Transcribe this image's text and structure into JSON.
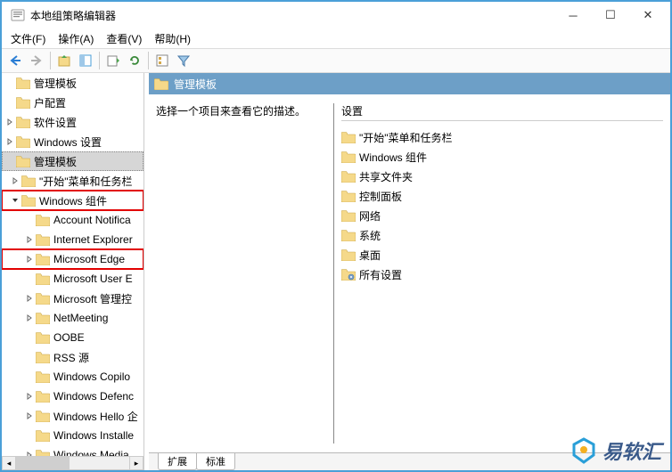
{
  "titlebar": {
    "title": "本地组策略编辑器"
  },
  "menubar": [
    "文件(F)",
    "操作(A)",
    "查看(V)",
    "帮助(H)"
  ],
  "tree": {
    "items": [
      {
        "label": "管理模板",
        "level": 0,
        "arrow": "none"
      },
      {
        "label": "户配置",
        "level": 0,
        "arrow": "none"
      },
      {
        "label": "软件设置",
        "level": 0,
        "arrow": "right"
      },
      {
        "label": "Windows 设置",
        "level": 0,
        "arrow": "right"
      },
      {
        "label": "管理模板",
        "level": 0,
        "arrow": "none",
        "selected": true
      },
      {
        "label": "\"开始\"菜单和任务栏",
        "level": 1,
        "arrow": "right"
      },
      {
        "label": "Windows 组件",
        "level": 1,
        "arrow": "down",
        "redbox": true
      },
      {
        "label": "Account Notifica",
        "level": 2,
        "arrow": "none"
      },
      {
        "label": "Internet Explorer",
        "level": 2,
        "arrow": "right"
      },
      {
        "label": "Microsoft Edge",
        "level": 2,
        "arrow": "right",
        "redbox": true
      },
      {
        "label": "Microsoft User E",
        "level": 2,
        "arrow": "none"
      },
      {
        "label": "Microsoft 管理控",
        "level": 2,
        "arrow": "right"
      },
      {
        "label": "NetMeeting",
        "level": 2,
        "arrow": "right"
      },
      {
        "label": "OOBE",
        "level": 2,
        "arrow": "none"
      },
      {
        "label": "RSS 源",
        "level": 2,
        "arrow": "none"
      },
      {
        "label": "Windows Copilo",
        "level": 2,
        "arrow": "none"
      },
      {
        "label": "Windows Defenc",
        "level": 2,
        "arrow": "right"
      },
      {
        "label": "Windows Hello 企",
        "level": 2,
        "arrow": "right"
      },
      {
        "label": "Windows Installe",
        "level": 2,
        "arrow": "none"
      },
      {
        "label": "Windows Media",
        "level": 2,
        "arrow": "right"
      }
    ]
  },
  "rightHeader": "管理模板",
  "descText": "选择一个项目来查看它的描述。",
  "settingHeader": "设置",
  "settings": [
    {
      "label": "\"开始\"菜单和任务栏",
      "icon": "folder"
    },
    {
      "label": "Windows 组件",
      "icon": "folder"
    },
    {
      "label": "共享文件夹",
      "icon": "folder"
    },
    {
      "label": "控制面板",
      "icon": "folder"
    },
    {
      "label": "网络",
      "icon": "folder"
    },
    {
      "label": "系统",
      "icon": "folder"
    },
    {
      "label": "桌面",
      "icon": "folder"
    },
    {
      "label": "所有设置",
      "icon": "gear-folder"
    }
  ],
  "tabs": {
    "extended": "扩展",
    "standard": "标准"
  },
  "watermark": "易软汇"
}
